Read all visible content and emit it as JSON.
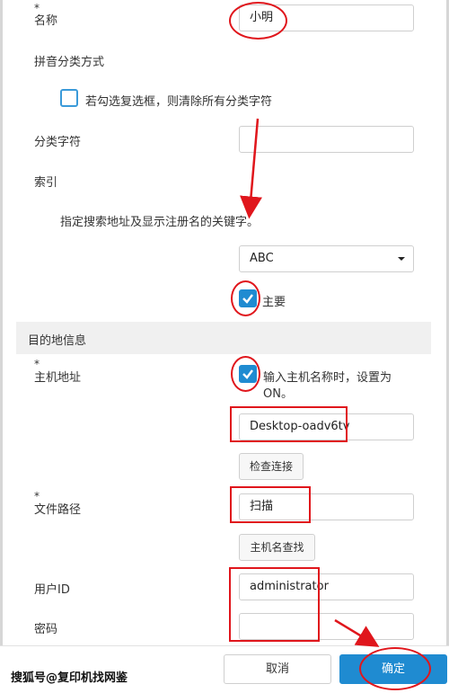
{
  "form": {
    "required_mark": "*",
    "name": {
      "label": "名称",
      "value": "小明"
    },
    "phonetic_sort": {
      "label": "拼音分类方式",
      "checkbox_text": "若勾选复选框，则清除所有分类字符",
      "checked": false
    },
    "sort_char": {
      "label": "分类字符",
      "value": ""
    },
    "index": {
      "label": "索引",
      "description": "指定搜索地址及显示注册名的关键字。",
      "selected": "ABC"
    },
    "main": {
      "label": "主要",
      "checked": true
    }
  },
  "destination": {
    "section_title": "目的地信息",
    "host": {
      "label": "主机地址",
      "checkbox_text_line1": "输入主机名称时，设置为",
      "checkbox_text_line2": "ON。",
      "checked": true,
      "value": "Desktop-oadv6tv",
      "check_button": "检查连接"
    },
    "path": {
      "label": "文件路径",
      "value": "扫描",
      "lookup_button": "主机名查找"
    },
    "user_id": {
      "label": "用户ID",
      "value": "administrator"
    },
    "password": {
      "label": "密码",
      "value": ""
    }
  },
  "footer": {
    "cancel": "取消",
    "confirm": "确定"
  },
  "watermark": "搜狐号@复印机找网鉴",
  "colors": {
    "accent": "#1f8bd1",
    "annotation": "#e0161c",
    "section_bg": "#f0f0f0"
  },
  "icons": {
    "checkbox_check": "check-icon",
    "select_caret": "caret-down-icon"
  }
}
